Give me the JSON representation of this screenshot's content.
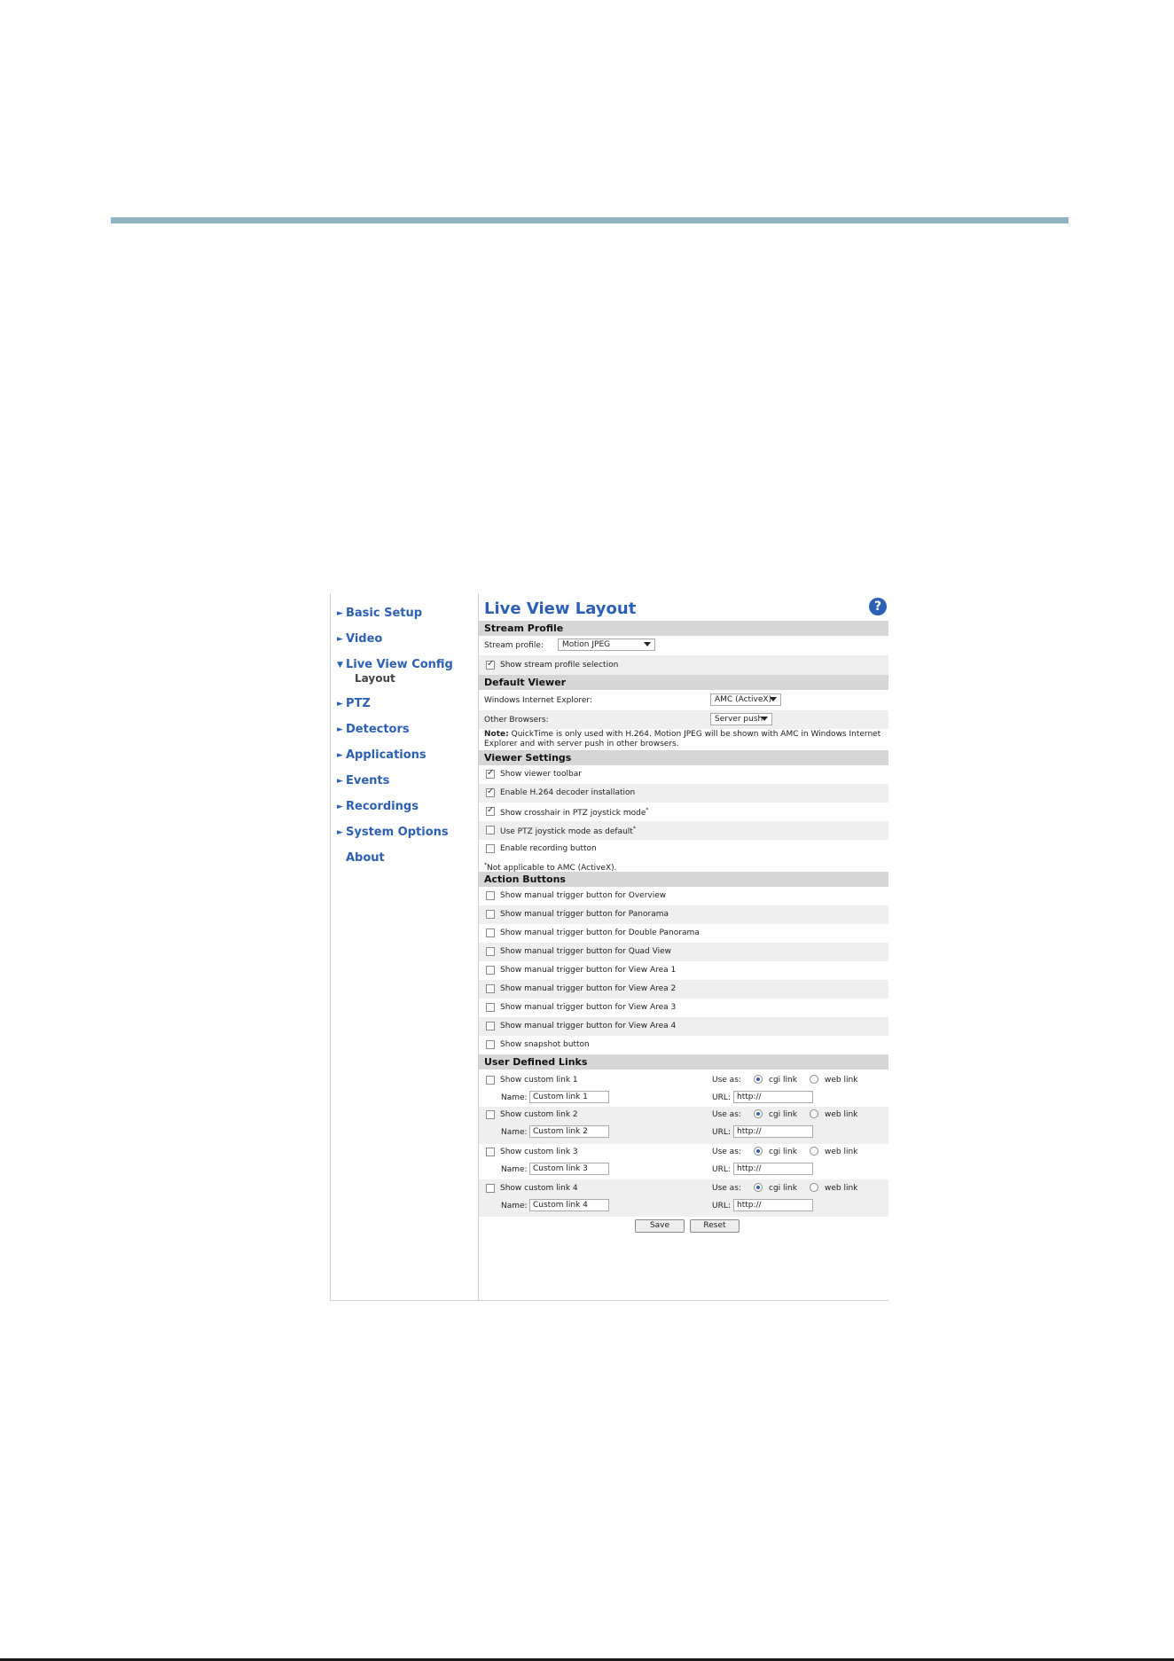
{
  "nav": {
    "items": [
      {
        "label": "Basic Setup",
        "arrow": "right"
      },
      {
        "label": "Video",
        "arrow": "right"
      },
      {
        "label": "Live View Config",
        "arrow": "down"
      },
      {
        "label": "PTZ",
        "arrow": "right"
      },
      {
        "label": "Detectors",
        "arrow": "right"
      },
      {
        "label": "Applications",
        "arrow": "right"
      },
      {
        "label": "Events",
        "arrow": "right"
      },
      {
        "label": "Recordings",
        "arrow": "right"
      },
      {
        "label": "System Options",
        "arrow": "right"
      },
      {
        "label": "About",
        "arrow": "none"
      }
    ],
    "sub_item": "Layout"
  },
  "page": {
    "title": "Live View Layout",
    "help_glyph": "?"
  },
  "stream_profile": {
    "heading": "Stream Profile",
    "label": "Stream profile:",
    "value": "Motion JPEG",
    "show_selection": {
      "label": "Show stream profile selection",
      "checked": true
    }
  },
  "default_viewer": {
    "heading": "Default Viewer",
    "ie_label": "Windows Internet Explorer:",
    "ie_value": "AMC (ActiveX)",
    "other_label": "Other Browsers:",
    "other_value": "Server push",
    "note_prefix": "Note:",
    "note_text": "QuickTime is only used with H.264. Motion JPEG will be shown with AMC in Windows Internet Explorer and with server push in other browsers."
  },
  "viewer_settings": {
    "heading": "Viewer Settings",
    "items": [
      {
        "label": "Show viewer toolbar",
        "checked": true,
        "star": false
      },
      {
        "label": "Enable H.264 decoder installation",
        "checked": true,
        "star": false
      },
      {
        "label": "Show crosshair in PTZ joystick mode",
        "checked": true,
        "star": true
      },
      {
        "label": "Use PTZ joystick mode as default",
        "checked": false,
        "star": true
      },
      {
        "label": "Enable recording button",
        "checked": false,
        "star": false
      }
    ],
    "footnote_mark": "*",
    "footnote": "Not applicable to AMC (ActiveX)."
  },
  "action_buttons": {
    "heading": "Action Buttons",
    "items": [
      {
        "label": "Show manual trigger button for Overview",
        "checked": false
      },
      {
        "label": "Show manual trigger button for Panorama",
        "checked": false
      },
      {
        "label": "Show manual trigger button for Double Panorama",
        "checked": false
      },
      {
        "label": "Show manual trigger button for Quad View",
        "checked": false
      },
      {
        "label": "Show manual trigger button for View Area 1",
        "checked": false
      },
      {
        "label": "Show manual trigger button for View Area 2",
        "checked": false
      },
      {
        "label": "Show manual trigger button for View Area 3",
        "checked": false
      },
      {
        "label": "Show manual trigger button for View Area 4",
        "checked": false
      },
      {
        "label": "Show snapshot button",
        "checked": false
      }
    ]
  },
  "user_links": {
    "heading": "User Defined Links",
    "use_as_label": "Use as:",
    "cgi_label": "cgi link",
    "web_label": "web link",
    "name_label": "Name:",
    "url_label": "URL:",
    "links": [
      {
        "label": "Show custom link 1",
        "checked": false,
        "name": "Custom link 1",
        "url": "http://",
        "use_as": "cgi"
      },
      {
        "label": "Show custom link 2",
        "checked": false,
        "name": "Custom link 2",
        "url": "http://",
        "use_as": "cgi"
      },
      {
        "label": "Show custom link 3",
        "checked": false,
        "name": "Custom link 3",
        "url": "http://",
        "use_as": "cgi"
      },
      {
        "label": "Show custom link 4",
        "checked": false,
        "name": "Custom link 4",
        "url": "http://",
        "use_as": "cgi"
      }
    ]
  },
  "buttons": {
    "save": "Save",
    "reset": "Reset"
  },
  "colors": {
    "accent": "#2b60b5",
    "section_header": "#d6d6d6",
    "top_rule": "#8fb5c5"
  }
}
